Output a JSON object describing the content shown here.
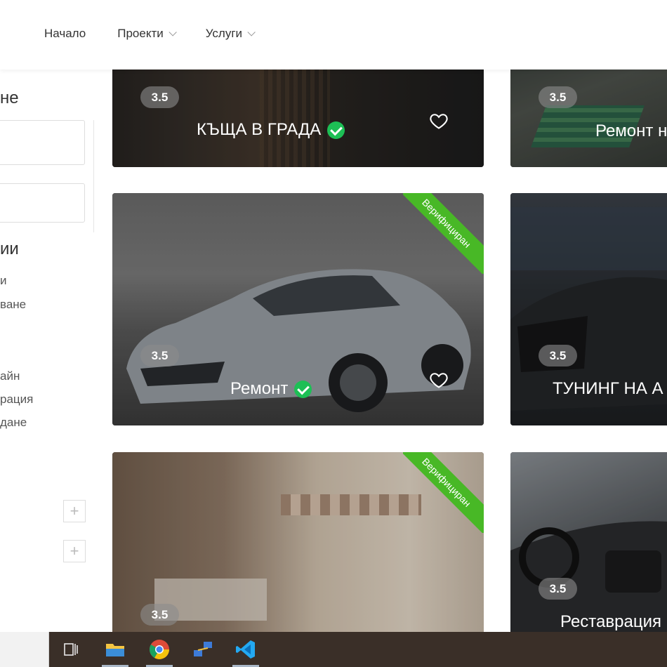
{
  "nav": {
    "home": "Начало",
    "projects": "Проекти",
    "services": "Услуги"
  },
  "sidebar": {
    "heading1": "не",
    "heading2": "ии",
    "links": [
      "и",
      "ване",
      "айн",
      "рация",
      "дане"
    ]
  },
  "cards": [
    {
      "title": "КЪЩА В ГРАДА",
      "rating": "3.5",
      "verified": true,
      "ribbon": ""
    },
    {
      "title": "Ремонт н",
      "rating": "3.5",
      "verified": false,
      "ribbon": ""
    },
    {
      "title": "Ремонт",
      "rating": "3.5",
      "verified": true,
      "ribbon": "Верифициран"
    },
    {
      "title": "ТУНИНГ НА А",
      "rating": "3.5",
      "verified": false,
      "ribbon": ""
    },
    {
      "title": "",
      "rating": "3.5",
      "verified": false,
      "ribbon": "Верифициран"
    },
    {
      "title": "Реставрация",
      "rating": "3.5",
      "verified": false,
      "ribbon": ""
    }
  ],
  "colors": {
    "accent_green": "#48b826",
    "check_green": "#1dbf55",
    "taskbar": "#3a2f28"
  },
  "taskbar": {
    "icons": [
      "task-view-icon",
      "file-explorer-icon",
      "chrome-icon",
      "network-icon",
      "vscode-icon"
    ]
  }
}
